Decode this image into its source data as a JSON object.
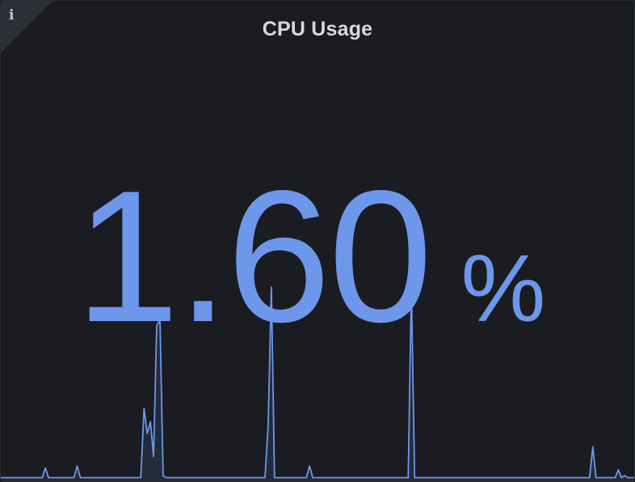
{
  "panel": {
    "title": "CPU Usage",
    "info_icon": "info-icon"
  },
  "stat": {
    "value": "1.60",
    "unit": "%"
  },
  "colors": {
    "panel_background": "#1a1c21",
    "series_color": "#6c97ea",
    "title_color": "#d8d9de"
  },
  "chart_data": {
    "type": "area",
    "title": "",
    "xlabel": "",
    "ylabel": "",
    "ylim": [
      0,
      100
    ],
    "x": [
      0,
      1,
      2,
      3,
      4,
      5,
      6,
      7,
      8,
      9,
      10,
      11,
      12,
      13,
      14,
      15,
      16,
      17,
      18,
      19,
      20,
      21,
      22,
      23,
      24,
      25,
      26,
      27,
      28,
      29,
      30,
      31,
      32,
      33,
      34,
      35,
      36,
      37,
      38,
      39,
      40,
      41,
      42,
      43,
      44,
      45,
      46,
      47,
      48,
      49,
      50,
      51,
      52,
      53,
      54,
      55,
      56,
      57,
      58,
      59,
      60,
      61,
      62,
      63,
      64,
      65,
      66,
      67,
      68,
      69,
      70,
      71,
      72,
      73,
      74,
      75,
      76,
      77,
      78,
      79,
      80,
      81,
      82,
      83,
      84,
      85,
      86,
      87,
      88,
      89,
      90,
      91,
      92,
      93,
      94,
      95,
      96,
      97,
      98,
      99,
      100,
      101,
      102,
      103,
      104,
      105,
      106,
      107,
      108,
      109,
      110,
      111,
      112,
      113,
      114,
      115,
      116,
      117,
      118,
      119,
      120,
      121,
      122,
      123,
      124,
      125,
      126,
      127,
      128,
      129,
      130,
      131,
      132,
      133,
      134,
      135,
      136,
      137,
      138,
      139,
      140,
      141,
      142,
      143,
      144,
      145,
      146,
      147,
      148,
      149,
      150,
      151,
      152,
      153,
      154,
      155,
      156,
      157,
      158,
      159,
      160,
      161,
      162,
      163,
      164,
      165,
      166,
      167,
      168,
      169,
      170,
      171,
      172,
      173,
      174,
      175,
      176,
      177,
      178,
      179,
      180,
      181,
      182,
      183,
      184,
      185,
      186,
      187,
      188,
      189,
      190,
      191,
      192,
      193,
      194,
      195,
      196,
      197,
      198,
      199
    ],
    "series": [
      {
        "values": [
          1,
          1,
          1,
          1,
          1,
          1,
          1,
          1,
          1,
          1,
          1,
          1,
          1,
          1,
          6,
          1,
          1,
          1,
          1,
          1,
          1,
          1,
          1,
          1,
          7,
          1,
          1,
          1,
          1,
          1,
          1,
          1,
          1,
          1,
          1,
          1,
          1,
          1,
          1,
          1,
          1,
          1,
          1,
          1,
          1,
          37,
          24,
          30,
          12,
          80,
          83,
          2,
          1,
          1,
          1,
          1,
          1,
          1,
          1,
          1,
          1,
          1,
          1,
          1,
          1,
          1,
          1,
          1,
          1,
          1,
          1,
          1,
          1,
          1,
          1,
          1,
          1,
          1,
          1,
          1,
          1,
          1,
          1,
          1,
          28,
          100,
          1,
          1,
          1,
          1,
          1,
          1,
          1,
          1,
          1,
          1,
          1,
          7,
          1,
          1,
          1,
          1,
          1,
          1,
          1,
          1,
          1,
          1,
          1,
          1,
          1,
          1,
          1,
          1,
          1,
          1,
          1,
          1,
          1,
          1,
          1,
          1,
          1,
          1,
          1,
          1,
          1,
          1,
          1,
          100,
          1,
          1,
          1,
          1,
          1,
          1,
          1,
          1,
          1,
          1,
          1,
          1,
          1,
          1,
          1,
          1,
          1,
          1,
          1,
          1,
          1,
          1,
          1,
          1,
          1,
          1,
          1,
          1,
          1,
          1,
          1,
          1,
          1,
          1,
          1,
          1,
          1,
          1,
          1,
          1,
          1,
          1,
          1,
          1,
          1,
          1,
          1,
          1,
          1,
          1,
          1,
          1,
          1,
          1,
          1,
          1,
          17,
          1,
          1,
          1,
          1,
          1,
          1,
          1,
          5,
          1,
          2,
          1,
          1,
          1
        ]
      }
    ]
  }
}
